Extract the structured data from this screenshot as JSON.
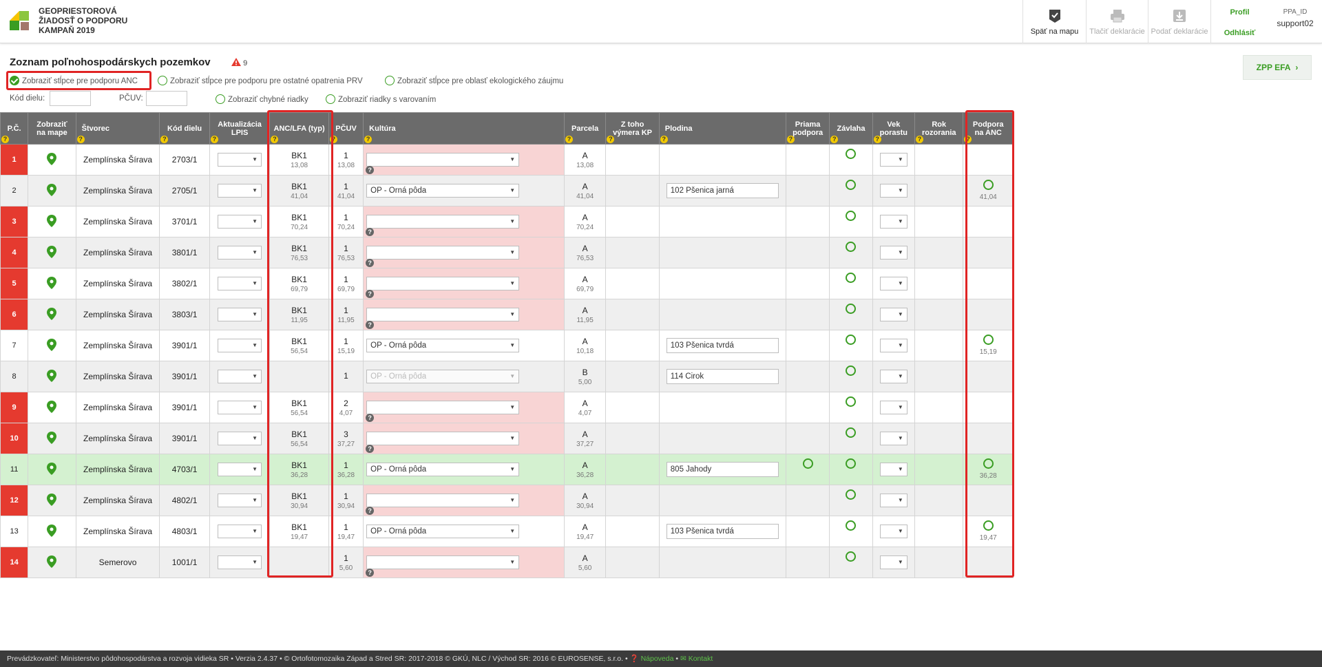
{
  "app": {
    "title_lines": [
      "GEOPRIESTOROVÁ",
      "ŽIADOSŤ O PODPORU",
      "KAMPAŇ 2019"
    ],
    "brand_color": "#3a9d23"
  },
  "header": {
    "back_to_map": "Späť na mapu",
    "print_declarations": "Tlačiť deklarácie",
    "submit_declarations": "Podať deklarácie",
    "profile": "Profil",
    "logout": "Odhlásiť",
    "ppa_label": "PPA_ID",
    "user": "support02"
  },
  "toolbar": {
    "title": "Zoznam poľnohospodárskych pozemkov",
    "warning_count": "9",
    "zpp_button": "ZPP EFA",
    "filter_anc": "Zobraziť stĺpce pre podporu ANC",
    "filter_prv": "Zobraziť stĺpce pre podporu pre ostatné opatrenia PRV",
    "filter_ekolog": "Zobraziť stĺpce pre oblasť ekologického záujmu",
    "kod_dielu_label": "Kód dielu:",
    "pcuv_label": "PČUV:",
    "filter_errors": "Zobraziť chybné riadky",
    "filter_warnings": "Zobraziť riadky s varovaním",
    "kod_dielu_value": "",
    "pcuv_value": ""
  },
  "columns": {
    "pc": "P.Č.",
    "map": [
      "Zobraziť",
      "na mape"
    ],
    "stvorec": "Štvorec",
    "kod": "Kód dielu",
    "lpis": [
      "Aktualizácia",
      "LPIS"
    ],
    "anc": "ANC/LFA (typ)",
    "pcuv": "PČUV",
    "kultura": "Kultúra",
    "parcela": "Parcela",
    "kp": [
      "Z toho",
      "výmera KP"
    ],
    "plodina": "Plodina",
    "priama": [
      "Priama",
      "podpora"
    ],
    "zavlaha": "Závlaha",
    "vek": [
      "Vek",
      "porastu"
    ],
    "rok": [
      "Rok",
      "rozorania"
    ],
    "podpora": [
      "Podpora",
      "na ANC"
    ]
  },
  "rows": [
    {
      "pc": "1",
      "err": true,
      "stvorec": "Zemplínska Šírava",
      "kod": "2703/1",
      "anc": "BK1",
      "anc_area": "13,08",
      "pcuv": "1",
      "pcuv_area": "13,08",
      "kultura": "",
      "parcela": "A",
      "parcela_area": "13,08",
      "plodina": "",
      "priama": false,
      "zavlaha": true,
      "podpora": false,
      "podpora_area": ""
    },
    {
      "pc": "2",
      "err": false,
      "stvorec": "Zemplínska Šírava",
      "kod": "2705/1",
      "anc": "BK1",
      "anc_area": "41,04",
      "pcuv": "1",
      "pcuv_area": "41,04",
      "kultura": "OP - Orná pôda",
      "parcela": "A",
      "parcela_area": "41,04",
      "plodina": "102  Pšenica jarná",
      "priama": false,
      "zavlaha": true,
      "podpora": true,
      "podpora_area": "41,04"
    },
    {
      "pc": "3",
      "err": true,
      "stvorec": "Zemplínska Šírava",
      "kod": "3701/1",
      "anc": "BK1",
      "anc_area": "70,24",
      "pcuv": "1",
      "pcuv_area": "70,24",
      "kultura": "",
      "parcela": "A",
      "parcela_area": "70,24",
      "plodina": "",
      "priama": false,
      "zavlaha": true,
      "podpora": false,
      "podpora_area": ""
    },
    {
      "pc": "4",
      "err": true,
      "stvorec": "Zemplínska Šírava",
      "kod": "3801/1",
      "anc": "BK1",
      "anc_area": "76,53",
      "pcuv": "1",
      "pcuv_area": "76,53",
      "kultura": "",
      "parcela": "A",
      "parcela_area": "76,53",
      "plodina": "",
      "priama": false,
      "zavlaha": true,
      "podpora": false,
      "podpora_area": ""
    },
    {
      "pc": "5",
      "err": true,
      "stvorec": "Zemplínska Šírava",
      "kod": "3802/1",
      "anc": "BK1",
      "anc_area": "69,79",
      "pcuv": "1",
      "pcuv_area": "69,79",
      "kultura": "",
      "parcela": "A",
      "parcela_area": "69,79",
      "plodina": "",
      "priama": false,
      "zavlaha": true,
      "podpora": false,
      "podpora_area": ""
    },
    {
      "pc": "6",
      "err": true,
      "stvorec": "Zemplínska Šírava",
      "kod": "3803/1",
      "anc": "BK1",
      "anc_area": "11,95",
      "pcuv": "1",
      "pcuv_area": "11,95",
      "kultura": "",
      "parcela": "A",
      "parcela_area": "11,95",
      "plodina": "",
      "priama": false,
      "zavlaha": true,
      "podpora": false,
      "podpora_area": ""
    },
    {
      "pc": "7",
      "err": false,
      "stvorec": "Zemplínska Šírava",
      "kod": "3901/1",
      "anc": "BK1",
      "anc_area": "56,54",
      "pcuv": "1",
      "pcuv_area": "15,19",
      "kultura": "OP - Orná pôda",
      "parcela": "A",
      "parcela_area": "10,18",
      "plodina": "103  Pšenica tvrdá",
      "priama": false,
      "zavlaha": true,
      "podpora": true,
      "podpora_area": "15,19"
    },
    {
      "pc": "8",
      "err": false,
      "stvorec": "Zemplínska Šírava",
      "kod": "3901/1",
      "anc": "",
      "anc_area": "",
      "pcuv": "1",
      "pcuv_area": "",
      "kultura": "OP - Orná pôda",
      "kultura_disabled": true,
      "parcela": "B",
      "parcela_area": "5,00",
      "plodina": "114  Cirok",
      "priama": false,
      "zavlaha": true,
      "podpora": false,
      "podpora_area": ""
    },
    {
      "pc": "9",
      "err": true,
      "stvorec": "Zemplínska Šírava",
      "kod": "3901/1",
      "anc": "BK1",
      "anc_area": "56,54",
      "pcuv": "2",
      "pcuv_area": "4,07",
      "kultura": "",
      "parcela": "A",
      "parcela_area": "4,07",
      "plodina": "",
      "priama": false,
      "zavlaha": true,
      "podpora": false,
      "podpora_area": ""
    },
    {
      "pc": "10",
      "err": true,
      "stvorec": "Zemplínska Šírava",
      "kod": "3901/1",
      "anc": "BK1",
      "anc_area": "56,54",
      "pcuv": "3",
      "pcuv_area": "37,27",
      "kultura": "",
      "parcela": "A",
      "parcela_area": "37,27",
      "plodina": "",
      "priama": false,
      "zavlaha": true,
      "podpora": false,
      "podpora_area": ""
    },
    {
      "pc": "11",
      "err": false,
      "hilite": true,
      "stvorec": "Zemplínska Šírava",
      "kod": "4703/1",
      "anc": "BK1",
      "anc_area": "36,28",
      "pcuv": "1",
      "pcuv_area": "36,28",
      "kultura": "OP - Orná pôda",
      "parcela": "A",
      "parcela_area": "36,28",
      "plodina": "805  Jahody",
      "priama": true,
      "zavlaha": true,
      "podpora": true,
      "podpora_area": "36,28"
    },
    {
      "pc": "12",
      "err": true,
      "stvorec": "Zemplínska Šírava",
      "kod": "4802/1",
      "anc": "BK1",
      "anc_area": "30,94",
      "pcuv": "1",
      "pcuv_area": "30,94",
      "kultura": "",
      "parcela": "A",
      "parcela_area": "30,94",
      "plodina": "",
      "priama": false,
      "zavlaha": true,
      "podpora": false,
      "podpora_area": ""
    },
    {
      "pc": "13",
      "err": false,
      "stvorec": "Zemplínska Šírava",
      "kod": "4803/1",
      "anc": "BK1",
      "anc_area": "19,47",
      "pcuv": "1",
      "pcuv_area": "19,47",
      "kultura": "OP - Orná pôda",
      "parcela": "A",
      "parcela_area": "19,47",
      "plodina": "103  Pšenica tvrdá",
      "priama": false,
      "zavlaha": true,
      "podpora": true,
      "podpora_area": "19,47"
    },
    {
      "pc": "14",
      "err": true,
      "stvorec": "Semerovo",
      "kod": "1001/1",
      "anc": "",
      "anc_area": "",
      "pcuv": "1",
      "pcuv_area": "5,60",
      "kultura": "",
      "parcela": "A",
      "parcela_area": "5,60",
      "plodina": "",
      "priama": false,
      "zavlaha": true,
      "podpora": false,
      "podpora_area": ""
    }
  ],
  "footer": {
    "text": "Prevádzkovateľ: Ministerstvo pôdohospodárstva a rozvoja vidieka SR • Verzia 2.4.37 • © Ortofotomozaika Západ a Stred SR: 2017-2018 © GKÚ, NLC / Východ SR: 2016 © EUROSENSE, s.r.o. •",
    "help": "Nápoveda",
    "contact": "Kontakt"
  },
  "icons": {
    "map_pin": "map-pin-icon",
    "qmark": "?",
    "warning": "warning-triangle-icon"
  }
}
